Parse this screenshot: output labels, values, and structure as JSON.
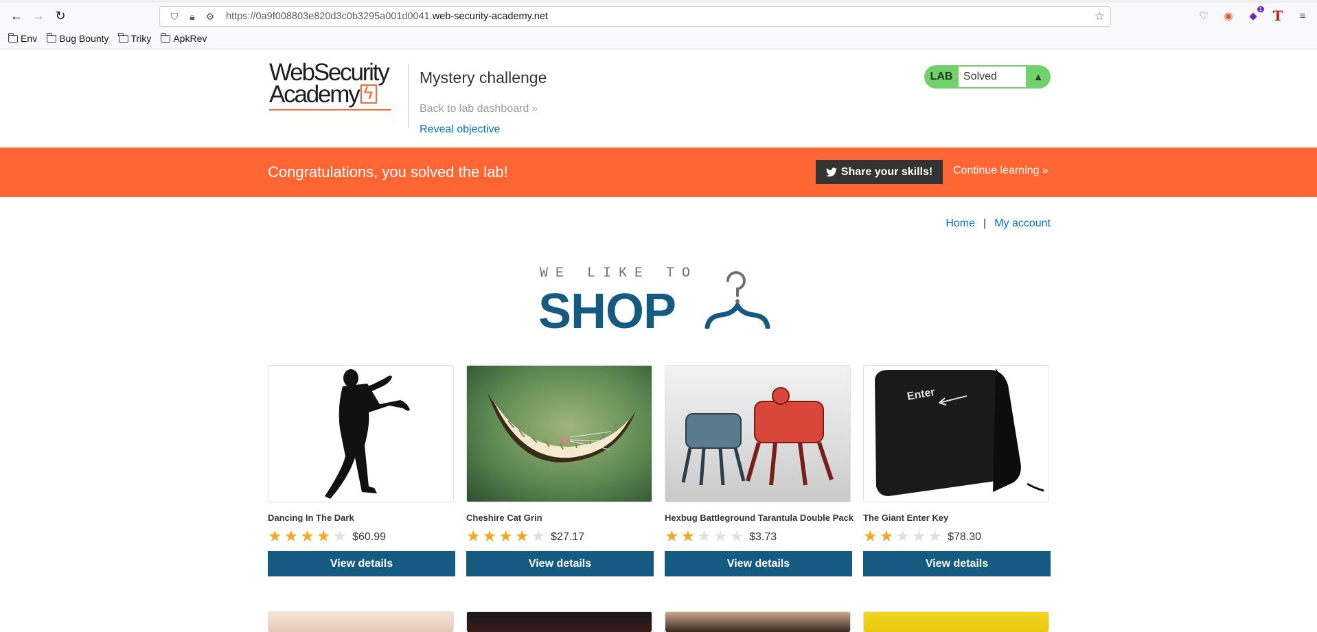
{
  "browser": {
    "url_prefix": "https://0a9f008803e820d3c0b3295a001d0041.",
    "url_domain": "web-security-academy.net",
    "bookmarks": [
      "Env",
      "Bug Bounty",
      "Triky",
      "ApkRev"
    ],
    "extension_badge": "1"
  },
  "lab": {
    "logo_line1": "WebSecurity",
    "logo_line2": "Academy",
    "title": "Mystery challenge",
    "back_link": "Back to lab dashboard",
    "reveal": "Reveal objective",
    "status_label": "LAB",
    "status_value": "Solved"
  },
  "banner": {
    "message": "Congratulations, you solved the lab!",
    "share": "Share your skills!",
    "continue": "Continue learning"
  },
  "nav": {
    "home": "Home",
    "separator": "|",
    "account": "My account"
  },
  "hero": {
    "tag": "WE LIKE TO",
    "word": "SHOP"
  },
  "products": [
    {
      "name": "Dancing In The Dark",
      "rating": 4,
      "price": "$60.99",
      "button": "View details"
    },
    {
      "name": "Cheshire Cat Grin",
      "rating": 4,
      "price": "$27.17",
      "button": "View details"
    },
    {
      "name": "Hexbug Battleground Tarantula Double Pack",
      "rating": 2,
      "price": "$3.73",
      "button": "View details"
    },
    {
      "name": "The Giant Enter Key",
      "rating": 2,
      "price": "$78.30",
      "button": "View details"
    }
  ],
  "enter_key_text": "Enter",
  "colors": {
    "brand_orange": "#ff6633",
    "primary_blue": "#155a80",
    "link_blue": "#0071bc",
    "lab_solved_green": "#70d16d",
    "star": "#f5a623"
  }
}
